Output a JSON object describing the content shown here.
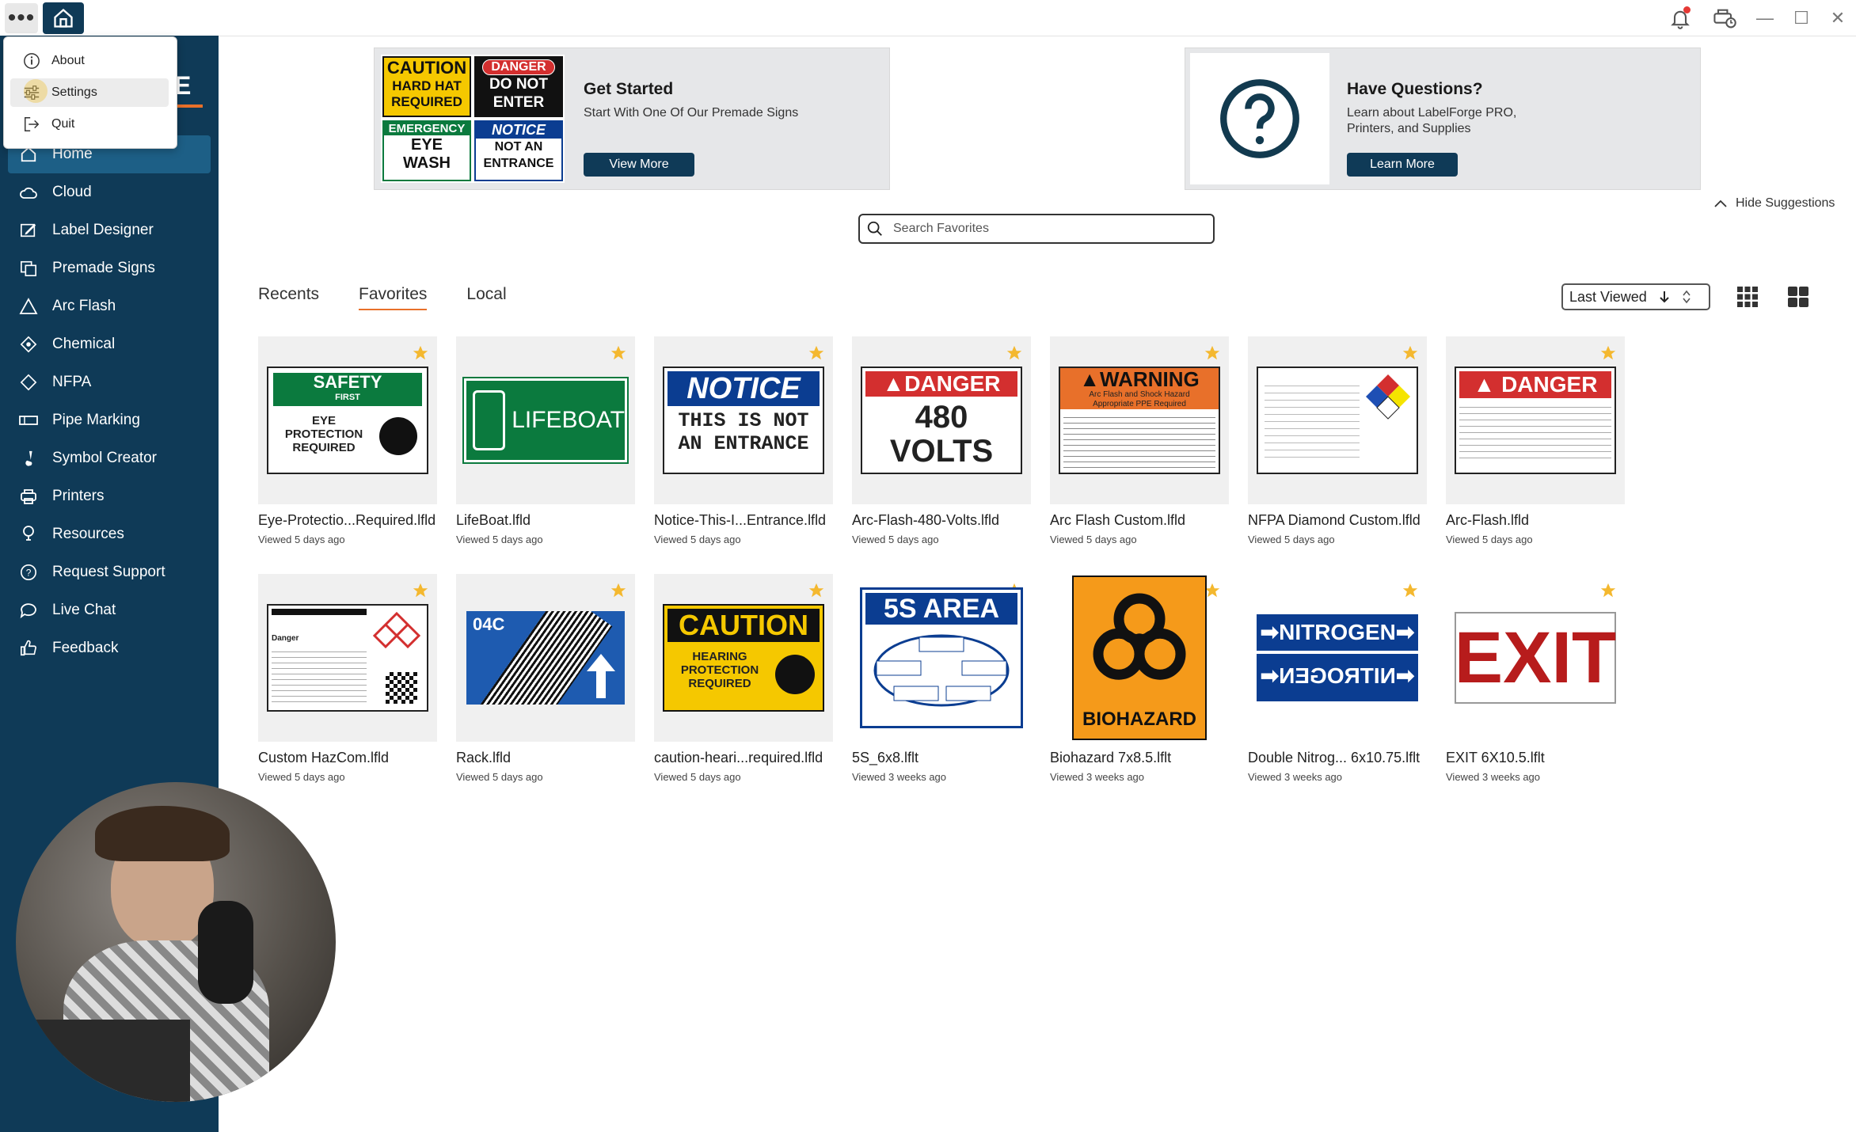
{
  "titlebar": {
    "menu_glyph": "•••",
    "window_controls": [
      "—",
      "☐",
      "✕"
    ]
  },
  "dropdown": {
    "items": [
      {
        "label": "About",
        "icon": "info-icon"
      },
      {
        "label": "Settings",
        "icon": "sliders-icon"
      },
      {
        "label": "Quit",
        "icon": "logout-icon"
      }
    ]
  },
  "brand": {
    "partial_text": "E"
  },
  "sidebar": {
    "items": [
      {
        "label": "Home",
        "icon": "home-icon",
        "active": true
      },
      {
        "label": "Cloud",
        "icon": "cloud-icon"
      },
      {
        "label": "Label Designer",
        "icon": "edit-icon"
      },
      {
        "label": "Premade Signs",
        "icon": "signs-icon"
      },
      {
        "label": "Arc Flash",
        "icon": "warning-icon"
      },
      {
        "label": "Chemical",
        "icon": "diamond-icon"
      },
      {
        "label": "NFPA",
        "icon": "diamond-outline-icon"
      },
      {
        "label": "Pipe Marking",
        "icon": "pipe-icon"
      },
      {
        "label": "Symbol Creator",
        "icon": "brush-icon"
      },
      {
        "label": "Printers",
        "icon": "printer-icon"
      },
      {
        "label": "Resources",
        "icon": "lightbulb-icon"
      },
      {
        "label": "Request Support",
        "icon": "help-icon"
      },
      {
        "label": "Live Chat",
        "icon": "chat-icon"
      },
      {
        "label": "Feedback",
        "icon": "thumbs-up-icon"
      }
    ]
  },
  "suggestions": {
    "get_started": {
      "title": "Get Started",
      "subtitle": "Start With One Of Our Premade Signs",
      "button": "View More",
      "sign_tiles": [
        {
          "top": "CAUTION",
          "lines": [
            "HARD HAT",
            "REQUIRED"
          ]
        },
        {
          "top": "DANGER",
          "lines": [
            "DO NOT",
            "ENTER"
          ]
        },
        {
          "top": "EMERGENCY",
          "lines": [
            "EYE",
            "WASH"
          ]
        },
        {
          "top": "NOTICE",
          "lines": [
            "NOT AN",
            "ENTRANCE"
          ]
        }
      ]
    },
    "questions": {
      "title": "Have Questions?",
      "subtitle_line1": "Learn about LabelForge PRO,",
      "subtitle_line2": "Printers, and Supplies",
      "button": "Learn More"
    },
    "hide_label": "Hide Suggestions"
  },
  "search": {
    "placeholder": "Search Favorites"
  },
  "tabs": [
    {
      "label": "Recents"
    },
    {
      "label": "Favorites",
      "active": true
    },
    {
      "label": "Local"
    }
  ],
  "sort": {
    "label": "Last Viewed"
  },
  "colors": {
    "sidebar": "#0f3a57",
    "accent": "#e8702a",
    "star": "#f4b82f",
    "danger": "#d32f2f",
    "notice_blue": "#0b3d91",
    "safety_green": "#0b7a3e",
    "caution_yellow": "#f5c800"
  },
  "files": [
    {
      "name": "Eye-Protectio...Required.lfld",
      "meta": "Viewed 5 days ago",
      "thumb": "safety",
      "t1": "SAFETY",
      "t2": "FIRST",
      "t3": "EYE\nPROTECTION\nREQUIRED"
    },
    {
      "name": "LifeBoat.lfld",
      "meta": "Viewed 5 days ago",
      "thumb": "lifeboat",
      "t1": "LIFEBOAT"
    },
    {
      "name": "Notice-This-I...Entrance.lfld",
      "meta": "Viewed 5 days ago",
      "thumb": "notice",
      "t1": "NOTICE",
      "t2": "THIS IS NOT",
      "t3": "AN ENTRANCE"
    },
    {
      "name": "Arc-Flash-480-Volts.lfld",
      "meta": "Viewed 5 days ago",
      "thumb": "danger480",
      "t1": "DANGER",
      "t2": "480",
      "t3": "VOLTS"
    },
    {
      "name": "Arc Flash Custom.lfld",
      "meta": "Viewed 5 days ago",
      "thumb": "warning",
      "t1": "WARNING",
      "t2": "Arc Flash and Shock Hazard",
      "t3": "Appropriate PPE Required"
    },
    {
      "name": "NFPA Diamond Custom.lfld",
      "meta": "Viewed 5 days ago",
      "thumb": "nfpa"
    },
    {
      "name": "Arc-Flash.lfld",
      "meta": "Viewed 5 days ago",
      "thumb": "dangerdoc",
      "t1": "DANGER"
    },
    {
      "name": "Custom HazCom.lfld",
      "meta": "Viewed 5 days ago",
      "thumb": "hazcom",
      "t1": "Danger"
    },
    {
      "name": "Rack.lfld",
      "meta": "Viewed 5 days ago",
      "thumb": "rack",
      "t1": "04C"
    },
    {
      "name": "caution-heari...required.lfld",
      "meta": "Viewed 5 days ago",
      "thumb": "caution",
      "t1": "CAUTION",
      "t2": "HEARING\nPROTECTION\nREQUIRED"
    },
    {
      "name": "5S_6x8.lflt",
      "meta": "Viewed 3 weeks ago",
      "thumb": "5s",
      "t1": "5S AREA"
    },
    {
      "name": "Biohazard 7x8.5.lflt",
      "meta": "Viewed 3 weeks ago",
      "thumb": "biohazard",
      "t1": "BIOHAZARD"
    },
    {
      "name": "Double Nitrog... 6x10.75.lflt",
      "meta": "Viewed 3 weeks ago",
      "thumb": "nitrogen",
      "t1": "NITROGEN"
    },
    {
      "name": "EXIT 6X10.5.lflt",
      "meta": "Viewed 3 weeks ago",
      "thumb": "exit",
      "t1": "EXIT"
    }
  ]
}
